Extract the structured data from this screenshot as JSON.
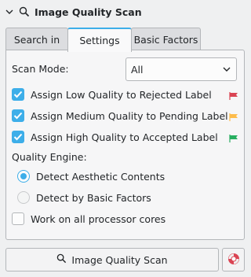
{
  "header": {
    "title": "Image Quality Scan",
    "chevron_icon": "chevron-down-icon",
    "search_icon": "search-icon"
  },
  "tabs": [
    {
      "label": "Search in",
      "active": false
    },
    {
      "label": "Settings",
      "active": true
    },
    {
      "label": "Basic Factors",
      "active": false
    }
  ],
  "settings": {
    "scan_mode_label": "Scan Mode:",
    "scan_mode_value": "All",
    "options": [
      {
        "label": "Assign Low Quality to Rejected Label",
        "checked": true,
        "flag_color": "#da4453"
      },
      {
        "label": "Assign Medium Quality to Pending Label",
        "checked": true,
        "flag_color": "#fdbc4b"
      },
      {
        "label": "Assign High Quality to Accepted Label",
        "checked": true,
        "flag_color": "#27ae60"
      }
    ],
    "quality_engine_label": "Quality Engine:",
    "engines": [
      {
        "label": "Detect Aesthetic Contents",
        "selected": true
      },
      {
        "label": "Detect by Basic Factors",
        "selected": false
      }
    ],
    "all_cores_label": "Work on all processor cores",
    "all_cores_checked": false
  },
  "footer": {
    "scan_button": "Image Quality Scan",
    "help_icon": "lifebuoy-icon"
  },
  "colors": {
    "accent": "#3daee9",
    "background": "#eff0f1"
  }
}
